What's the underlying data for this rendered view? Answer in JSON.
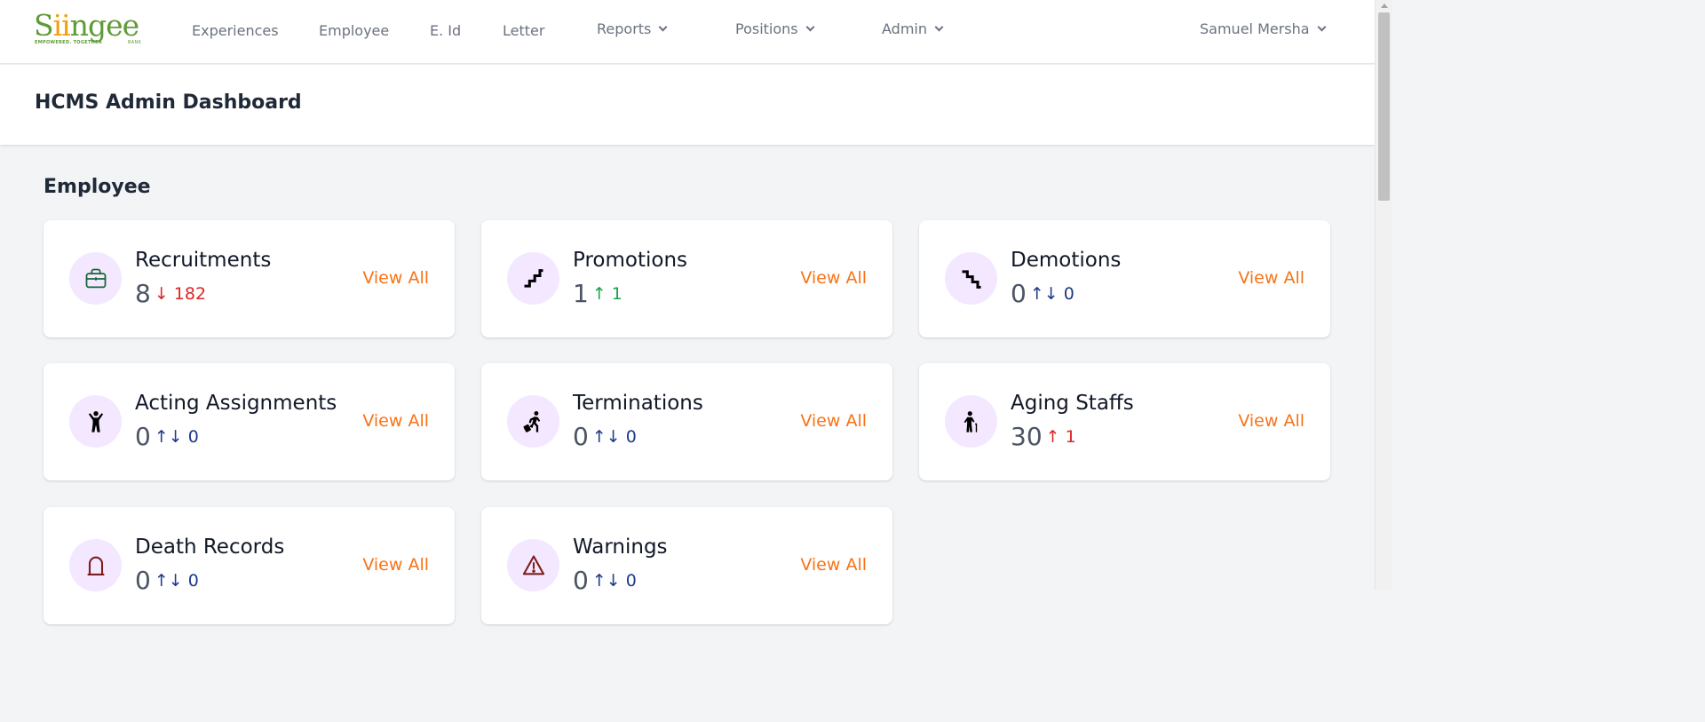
{
  "brand": {
    "logo_text_pre": "S",
    "logo_text_accent": "ii",
    "logo_text_post": "ngee",
    "tagline": "EMPOWERED. TOGETHER",
    "bank_label": "BANK",
    "green": "#5f9b36",
    "accent": "#f59e0b"
  },
  "nav": {
    "experiences": "Experiences",
    "employee": "Employee",
    "eid": "E. Id",
    "letter": "Letter",
    "reports": "Reports",
    "positions": "Positions",
    "admin": "Admin",
    "user": "Samuel Mersha"
  },
  "page": {
    "title": "HCMS Admin Dashboard",
    "section": "Employee"
  },
  "cards": [
    {
      "title": "Recruitments",
      "count": "8",
      "change": "↓ 182",
      "trend": "down",
      "icon": "briefcase-icon",
      "link": "View All"
    },
    {
      "title": "Promotions",
      "count": "1",
      "change": "↑ 1",
      "trend": "up",
      "icon": "stairs-up-icon",
      "link": "View All"
    },
    {
      "title": "Demotions",
      "count": "0",
      "change": "↑↓ 0",
      "trend": "neutral",
      "icon": "stairs-down-icon",
      "link": "View All"
    },
    {
      "title": "Acting Assignments",
      "count": "0",
      "change": "↑↓ 0",
      "trend": "neutral",
      "icon": "person-arms-up-icon",
      "link": "View All"
    },
    {
      "title": "Terminations",
      "count": "0",
      "change": "↑↓ 0",
      "trend": "neutral",
      "icon": "person-leaving-icon",
      "link": "View All"
    },
    {
      "title": "Aging Staffs",
      "count": "30",
      "change": "↑ 1",
      "trend": "up-red",
      "icon": "elderly-person-icon",
      "link": "View All"
    },
    {
      "title": "Death Records",
      "count": "0",
      "change": "↑↓ 0",
      "trend": "neutral",
      "icon": "tombstone-icon",
      "link": "View All"
    },
    {
      "title": "Warnings",
      "count": "0",
      "change": "↑↓ 0",
      "trend": "neutral",
      "icon": "warning-icon",
      "link": "View All"
    }
  ],
  "colors": {
    "link_orange": "#f97316",
    "icon_bg": "#f3e8ff",
    "down_red": "#dc2626",
    "up_green": "#16a34a",
    "neutral_blue": "#1e3a8a"
  }
}
